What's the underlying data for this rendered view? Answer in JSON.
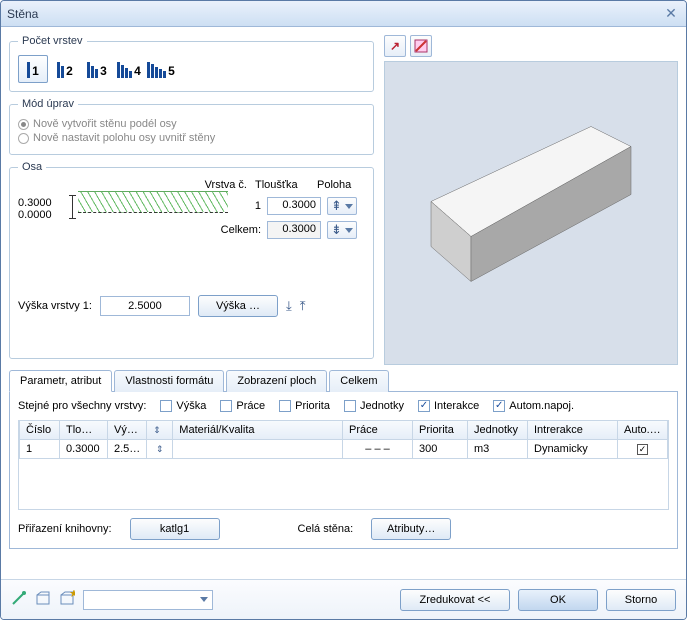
{
  "window": {
    "title": "Stěna"
  },
  "layer_count": {
    "legend": "Počet vrstev",
    "options": [
      "1",
      "2",
      "3",
      "4",
      "5"
    ],
    "active": 0
  },
  "edit_mode": {
    "legend": "Mód úprav",
    "opt1": "Nově vytvořit stěnu podél osy",
    "opt2": "Nově nastavit polohu osy uvnitř stěny"
  },
  "axis": {
    "legend": "Osa",
    "val_top": "0.3000",
    "val_bottom": "0.0000",
    "hdr_layer": "Vrstva č.",
    "hdr_thick": "Tloušťka",
    "hdr_pos": "Poloha",
    "row_layer": "1",
    "row_thick": "0.3000",
    "total_label": "Celkem:",
    "total_val": "0.3000"
  },
  "height": {
    "label": "Výška vrstvy 1:",
    "value": "2.5000",
    "button": "Výška …"
  },
  "tabs": {
    "t1": "Parametr, atribut",
    "t2": "Vlastnosti formátu",
    "t3": "Zobrazení ploch",
    "t4": "Celkem"
  },
  "same_for_all": {
    "label": "Stejné pro všechny vrstvy:",
    "c_height": "Výška",
    "c_work": "Práce",
    "c_prio": "Priorita",
    "c_units": "Jednotky",
    "c_inter": "Interakce",
    "c_auto": "Autom.napoj."
  },
  "grid": {
    "h_num": "Číslo",
    "h_thk": "Tlo…",
    "h_hgt": "Vý…",
    "h_hicon": "",
    "h_mat": "Materiál/Kvalita",
    "h_work": "Práce",
    "h_prio": "Priorita",
    "h_unit": "Jednotky",
    "h_inter": "Intrerakce",
    "h_auto": "Auto.…",
    "r_num": "1",
    "r_thk": "0.3000",
    "r_hgt": "2.5…",
    "r_mat": "",
    "r_work": "– – –",
    "r_prio": "300",
    "r_unit": "m3",
    "r_inter": "Dynamicky"
  },
  "library": {
    "label": "Přiřazení knihovny:",
    "value": "katlg1",
    "whole_label": "Celá stěna:",
    "attr_btn": "Atributy…"
  },
  "footer": {
    "reduce": "Zredukovat <<",
    "ok": "OK",
    "cancel": "Storno"
  },
  "icons": {
    "close": "close-icon",
    "expand": "expand-icon",
    "nav": "navigator-icon",
    "eyedrop": "eyedropper-icon",
    "fav": "favorite-icon",
    "fav_add": "favorite-add-icon"
  }
}
